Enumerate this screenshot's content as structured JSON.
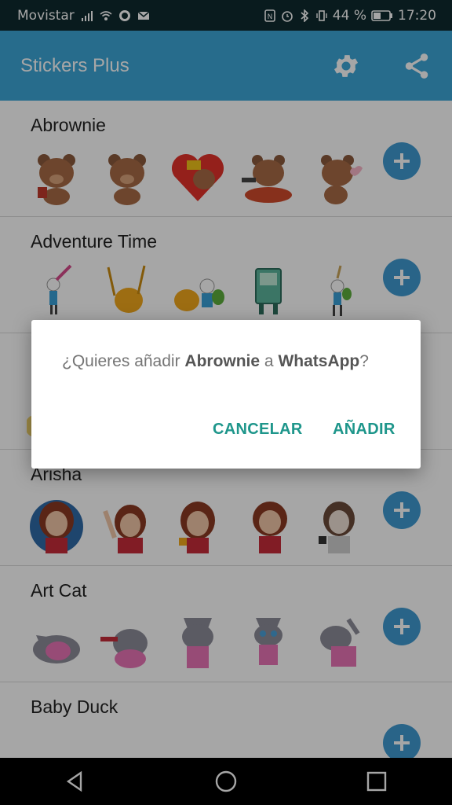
{
  "status_bar": {
    "carrier": "Movistar",
    "battery": "44 %",
    "time": "17:20"
  },
  "app_bar": {
    "title": "Stickers Plus",
    "settings_icon": "gear-icon",
    "share_icon": "share-icon"
  },
  "packs": [
    {
      "name": "Abrownie"
    },
    {
      "name": "Adventure Time"
    },
    {
      "name": ""
    },
    {
      "name": "Arisha"
    },
    {
      "name": "Art Cat"
    },
    {
      "name": "Baby Duck"
    }
  ],
  "dialog": {
    "prefix": "¿Quieres añadir ",
    "pack_name": "Abrownie",
    "middle": " a ",
    "app_name": "WhatsApp",
    "suffix": "?",
    "cancel_label": "CANCELAR",
    "add_label": "AÑADIR"
  },
  "colors": {
    "app_bar": "#3ca6d8",
    "accent_button": "#1e968b",
    "add_fab": "#3f9ad1"
  }
}
